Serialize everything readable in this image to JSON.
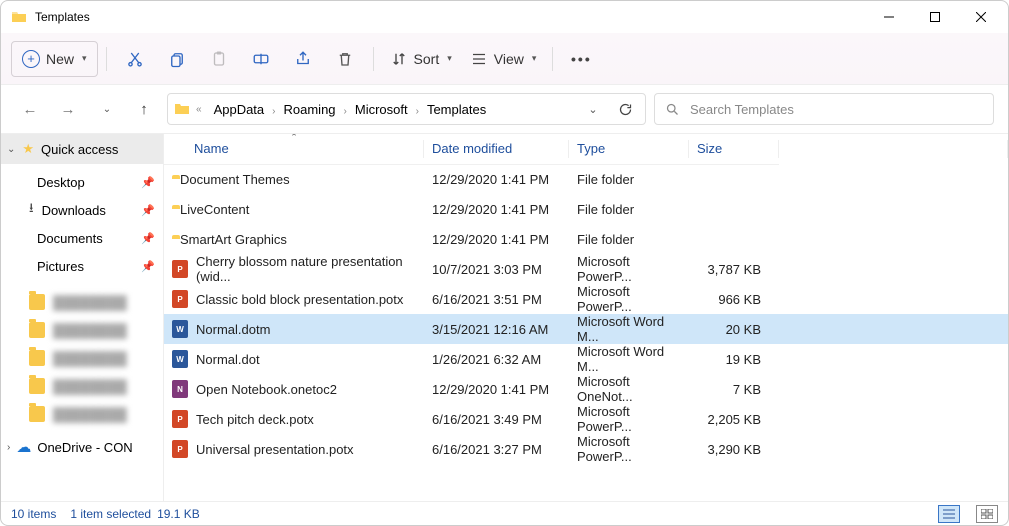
{
  "window": {
    "title": "Templates"
  },
  "toolbar": {
    "new_label": "New",
    "sort_label": "Sort",
    "view_label": "View"
  },
  "breadcrumb": {
    "prefix": "«",
    "items": [
      "AppData",
      "Roaming",
      "Microsoft",
      "Templates"
    ]
  },
  "search": {
    "placeholder": "Search Templates"
  },
  "sidebar": {
    "quick_access": "Quick access",
    "pinned": [
      {
        "label": "Desktop",
        "icon": "desktop"
      },
      {
        "label": "Downloads",
        "icon": "download"
      },
      {
        "label": "Documents",
        "icon": "document"
      },
      {
        "label": "Pictures",
        "icon": "picture"
      }
    ],
    "blurred_count": 5,
    "onedrive": "OneDrive - CON"
  },
  "columns": {
    "name": "Name",
    "date": "Date modified",
    "type": "Type",
    "size": "Size"
  },
  "files": [
    {
      "name": "Document Themes",
      "date": "12/29/2020 1:41 PM",
      "type": "File folder",
      "size": "",
      "icon": "folder",
      "selected": false
    },
    {
      "name": "LiveContent",
      "date": "12/29/2020 1:41 PM",
      "type": "File folder",
      "size": "",
      "icon": "folder",
      "selected": false
    },
    {
      "name": "SmartArt Graphics",
      "date": "12/29/2020 1:41 PM",
      "type": "File folder",
      "size": "",
      "icon": "folder",
      "selected": false
    },
    {
      "name": "Cherry blossom nature presentation (wid...",
      "date": "10/7/2021 3:03 PM",
      "type": "Microsoft PowerP...",
      "size": "3,787 KB",
      "icon": "ppt",
      "selected": false
    },
    {
      "name": "Classic bold block presentation.potx",
      "date": "6/16/2021 3:51 PM",
      "type": "Microsoft PowerP...",
      "size": "966 KB",
      "icon": "ppt",
      "selected": false
    },
    {
      "name": "Normal.dotm",
      "date": "3/15/2021 12:16 AM",
      "type": "Microsoft Word M...",
      "size": "20 KB",
      "icon": "word",
      "selected": true
    },
    {
      "name": "Normal.dot",
      "date": "1/26/2021 6:32 AM",
      "type": "Microsoft Word M...",
      "size": "19 KB",
      "icon": "word",
      "selected": false
    },
    {
      "name": "Open Notebook.onetoc2",
      "date": "12/29/2020 1:41 PM",
      "type": "Microsoft OneNot...",
      "size": "7 KB",
      "icon": "onenote",
      "selected": false
    },
    {
      "name": "Tech pitch deck.potx",
      "date": "6/16/2021 3:49 PM",
      "type": "Microsoft PowerP...",
      "size": "2,205 KB",
      "icon": "ppt",
      "selected": false
    },
    {
      "name": "Universal presentation.potx",
      "date": "6/16/2021 3:27 PM",
      "type": "Microsoft PowerP...",
      "size": "3,290 KB",
      "icon": "ppt",
      "selected": false
    }
  ],
  "status": {
    "count": "10 items",
    "selection": "1 item selected",
    "size": "19.1 KB"
  }
}
